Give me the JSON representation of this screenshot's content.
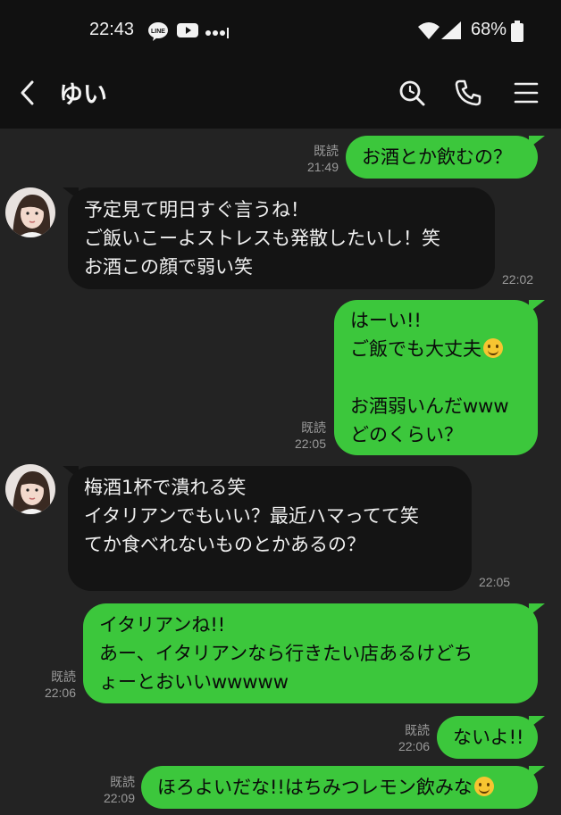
{
  "status_bar": {
    "time": "22:43",
    "battery": "68%",
    "icons": [
      "line-app-icon",
      "youtube-icon",
      "more-dots-icon",
      "wifi-icon",
      "signal-icon",
      "battery-icon"
    ]
  },
  "header": {
    "contact_name": "ゆい",
    "icons": [
      "back-icon",
      "search-icon",
      "phone-icon",
      "menu-icon"
    ]
  },
  "messages": [
    {
      "dir": "out",
      "read": "既読",
      "time": "21:49",
      "lines": [
        "お酒とか飲むの？"
      ]
    },
    {
      "dir": "in",
      "time": "22:02",
      "lines": [
        "予定見て明日すぐ言うね！",
        "ご飯いこーよストレスも発散したいし！笑",
        "お酒この顔で弱い笑"
      ]
    },
    {
      "dir": "out",
      "read": "既読",
      "time": "22:05",
      "lines": [
        "はーい!!",
        "ご飯でも大丈夫",
        "",
        "お酒弱いんだwww",
        "どのくらい？"
      ]
    },
    {
      "dir": "in",
      "time": "22:05",
      "lines": [
        "梅酒1杯で潰れる笑",
        "イタリアンでもいい？最近ハマってて笑",
        "てか食べれないものとかあるの？"
      ]
    },
    {
      "dir": "out",
      "read": "既読",
      "time": "22:06",
      "lines": [
        "イタリアンね!!",
        "あー、イタリアンなら行きたい店あるけどち",
        "ょーとおいいwwwww"
      ]
    },
    {
      "dir": "out",
      "read": "既読",
      "time": "22:06",
      "lines": [
        "ないよ!!"
      ]
    },
    {
      "dir": "out",
      "read": "既読",
      "time": "22:09",
      "lines": [
        "ほろよいだな!!はちみつレモン飲みな"
      ]
    }
  ],
  "colors": {
    "outgoing_bubble": "#3cc73c",
    "incoming_bubble": "#141414",
    "background": "#232323",
    "header": "#111111"
  }
}
